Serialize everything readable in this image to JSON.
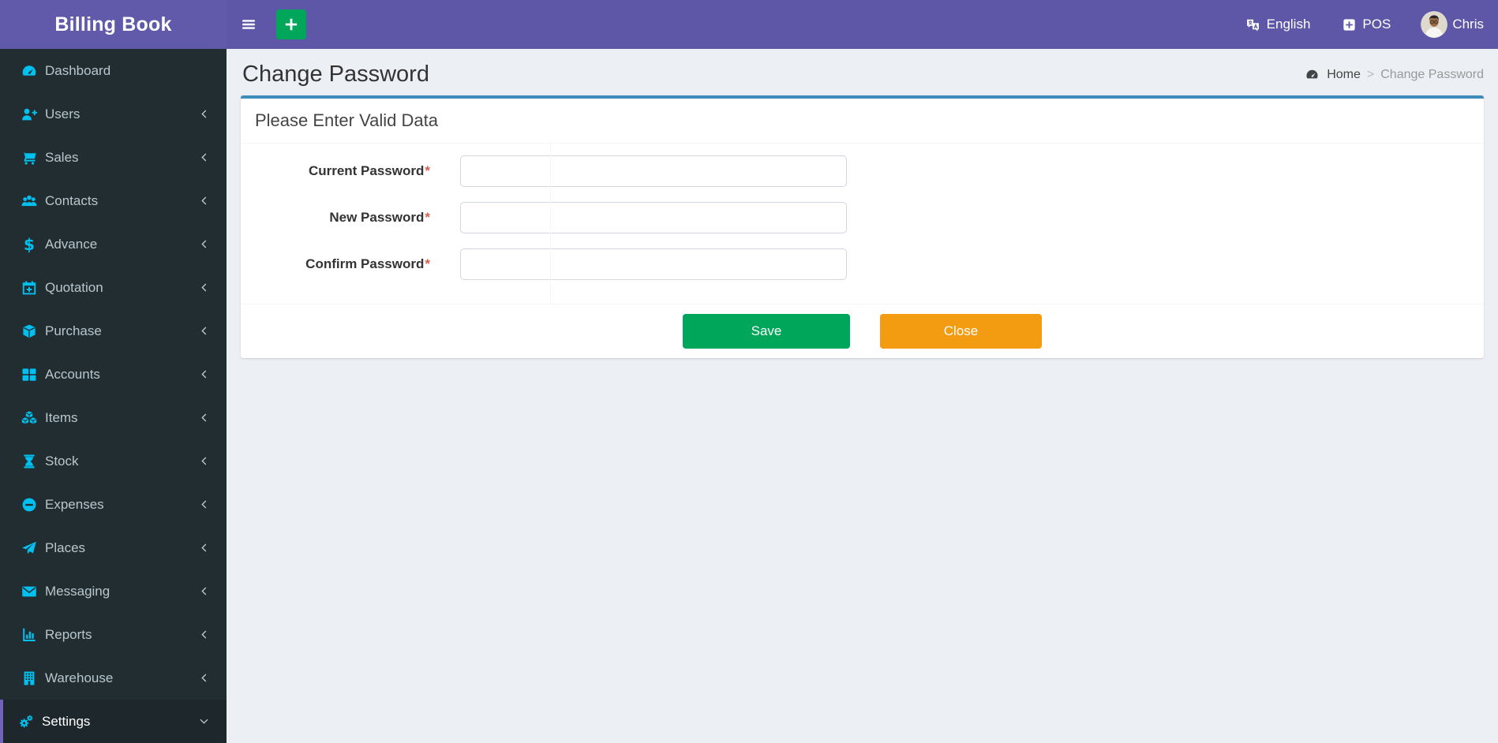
{
  "app": {
    "title": "Billing Book"
  },
  "navbar": {
    "hamburger_icon": "bars-icon",
    "quick_add_icon": "plus-icon",
    "language": {
      "icon": "language-icon",
      "label": "English"
    },
    "pos": {
      "icon": "plus-square-icon",
      "label": "POS"
    },
    "user": {
      "avatar_icon": "user-avatar-icon",
      "name": "Chris"
    }
  },
  "sidebar": {
    "items": [
      {
        "label": "Dashboard",
        "icon": "tachometer-icon",
        "chevron": "none",
        "active": false
      },
      {
        "label": "Users",
        "icon": "user-plus-icon",
        "chevron": "left",
        "active": false
      },
      {
        "label": "Sales",
        "icon": "cart-icon",
        "chevron": "left",
        "active": false
      },
      {
        "label": "Contacts",
        "icon": "users-icon",
        "chevron": "left",
        "active": false
      },
      {
        "label": "Advance",
        "icon": "dollar-icon",
        "chevron": "left",
        "active": false
      },
      {
        "label": "Quotation",
        "icon": "calendar-plus-icon",
        "chevron": "left",
        "active": false
      },
      {
        "label": "Purchase",
        "icon": "cube-icon",
        "chevron": "left",
        "active": false
      },
      {
        "label": "Accounts",
        "icon": "grid-icon",
        "chevron": "left",
        "active": false
      },
      {
        "label": "Items",
        "icon": "cubes-icon",
        "chevron": "left",
        "active": false
      },
      {
        "label": "Stock",
        "icon": "hourglass-icon",
        "chevron": "left",
        "active": false
      },
      {
        "label": "Expenses",
        "icon": "minus-circle-icon",
        "chevron": "left",
        "active": false
      },
      {
        "label": "Places",
        "icon": "paper-plane-icon",
        "chevron": "left",
        "active": false
      },
      {
        "label": "Messaging",
        "icon": "envelope-icon",
        "chevron": "left",
        "active": false
      },
      {
        "label": "Reports",
        "icon": "bar-chart-icon",
        "chevron": "left",
        "active": false
      },
      {
        "label": "Warehouse",
        "icon": "building-icon",
        "chevron": "left",
        "active": false
      },
      {
        "label": "Settings",
        "icon": "cogs-icon",
        "chevron": "down",
        "active": true
      }
    ]
  },
  "page": {
    "title": "Change Password",
    "breadcrumb": {
      "home_icon": "tachometer-icon",
      "home_label": "Home",
      "separator": ">",
      "current_label": "Change Password"
    }
  },
  "card": {
    "header": "Please Enter Valid Data",
    "fields": [
      {
        "label": "Current Password",
        "required_marker": "*",
        "value": ""
      },
      {
        "label": "New Password",
        "required_marker": "*",
        "value": ""
      },
      {
        "label": "Confirm Password",
        "required_marker": "*",
        "value": ""
      }
    ],
    "buttons": {
      "save": "Save",
      "close": "Close"
    }
  },
  "colors": {
    "navbar_purple": "#5e57a7",
    "sidebar_bg": "#222d32",
    "sidebar_active_bg": "#1e282c",
    "sidebar_text": "#b8c7ce",
    "icon_accent_cyan": "#00c0ef",
    "content_bg": "#ecf0f5",
    "card_top_border_blue": "#3c8dbc",
    "save_green": "#00a65a",
    "close_orange": "#f39c12",
    "required_red": "#d9604c"
  }
}
